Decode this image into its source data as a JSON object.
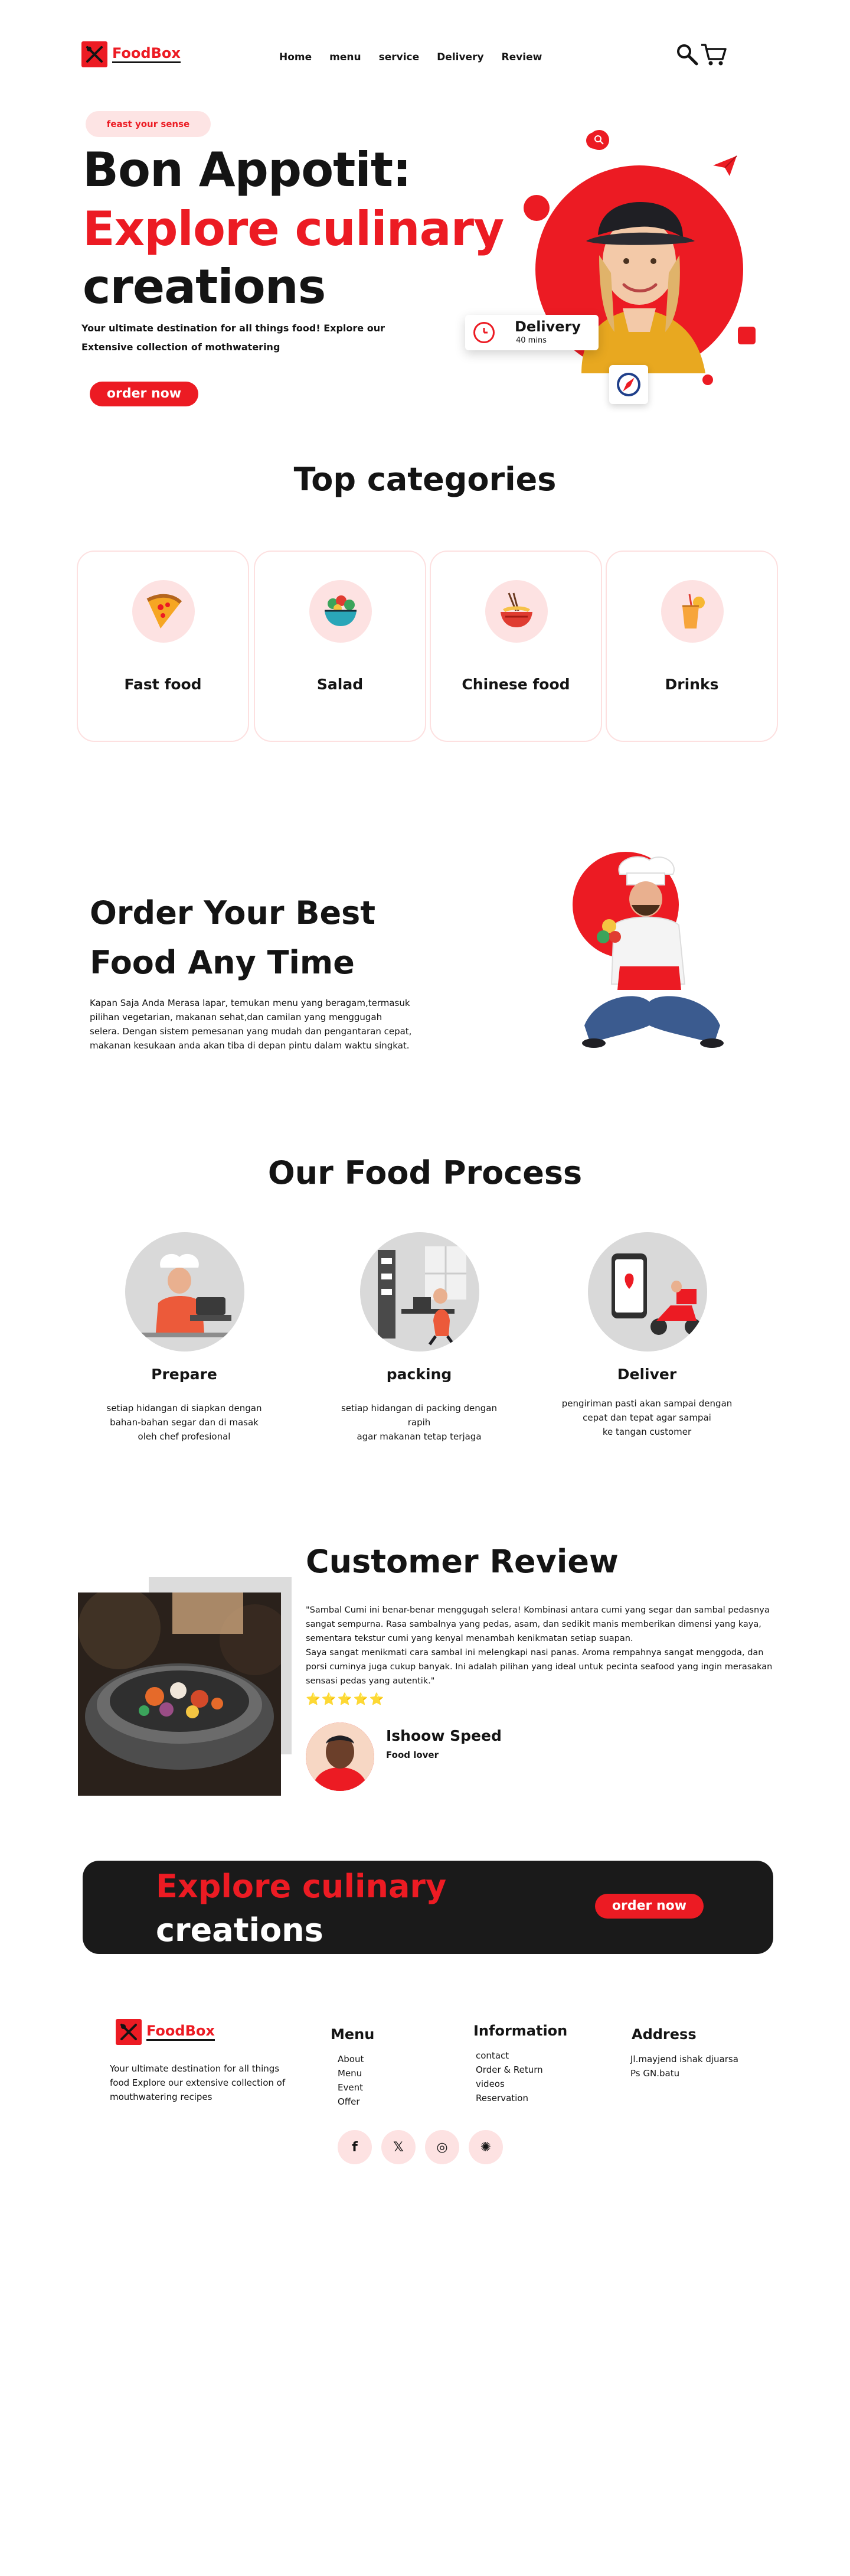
{
  "brand": {
    "name": "FoodBox"
  },
  "nav": {
    "links": [
      "Home",
      "menu",
      "service",
      "Delivery",
      "Review"
    ]
  },
  "hero": {
    "tag": "feast your sense",
    "line1": "Bon Appotit:",
    "line2": "Explore culinary",
    "line3": "creations",
    "subtitle_line1": "Your ultimate destination for all things food! Explore our",
    "subtitle_line2": "Extensive collection of mothwatering",
    "cta": "order now",
    "delivery_title": "Delivery",
    "delivery_time": "40 mins"
  },
  "categories": {
    "title": "Top categories",
    "items": [
      {
        "label": "Fast food",
        "icon": "pizza-icon"
      },
      {
        "label": "Salad",
        "icon": "salad-icon"
      },
      {
        "label": "Chinese food",
        "icon": "noodles-icon"
      },
      {
        "label": "Drinks",
        "icon": "drink-icon"
      }
    ]
  },
  "order": {
    "title_line1": "Order Your Best",
    "title_line2": "Food Any Time",
    "body": [
      "Kapan Saja Anda Merasa lapar, temukan menu yang beragam,termasuk",
      "pilihan vegetarian, makanan sehat,dan camilan yang menggugah",
      "selera. Dengan sistem pemesanan yang mudah dan pengantaran cepat,",
      "makanan kesukaan anda akan tiba di depan pintu dalam waktu singkat."
    ]
  },
  "process": {
    "title": "Our Food Process",
    "steps": [
      {
        "title": "Prepare",
        "desc": [
          "setiap hidangan di siapkan dengan",
          "bahan-bahan segar dan di masak",
          "oleh chef profesional"
        ]
      },
      {
        "title": "packing",
        "desc": [
          "setiap hidangan di packing dengan rapih",
          "agar makanan tetap terjaga"
        ]
      },
      {
        "title": "Deliver",
        "desc": [
          "pengiriman pasti akan sampai dengan",
          "cepat dan tepat agar sampai",
          "ke tangan customer"
        ]
      }
    ]
  },
  "review": {
    "title": "Customer Review",
    "text": [
      "\"Sambal Cumi ini benar-benar menggugah selera! Kombinasi antara cumi yang segar dan sambal pedasnya",
      "sangat sempurna. Rasa sambalnya yang pedas, asam, dan sedikit manis memberikan dimensi yang kaya,",
      "sementara tekstur cumi yang kenyal menambah kenikmatan setiap suapan.",
      "Saya sangat menikmati cara sambal ini melengkapi nasi panas. Aroma rempahnya sangat menggoda, dan",
      "porsi cuminya juga cukup banyak. Ini adalah pilihan yang ideal untuk pecinta seafood yang ingin merasakan",
      "sensasi pedas yang autentik.\""
    ],
    "stars": "⭐⭐⭐⭐⭐",
    "rating": 5,
    "reviewer_name": "Ishoow Speed",
    "reviewer_role": "Food lover"
  },
  "banner": {
    "line1": "Explore culinary",
    "line2": "creations",
    "cta": "order now"
  },
  "footer": {
    "desc": [
      "Your ultimate destination for all things",
      "food Explore our extensive collection of",
      "mouthwatering  recipes"
    ],
    "menu_title": "Menu",
    "menu_items": [
      "About",
      "Menu",
      "Event",
      "Offer"
    ],
    "info_title": "Information",
    "info_items": [
      "contact",
      "Order & Return",
      "videos",
      "Reservation"
    ],
    "address_title": "Address",
    "address_lines": [
      "Jl.mayjend ishak djuarsa",
      "Ps GN.batu"
    ],
    "socials": [
      {
        "label": "f",
        "icon": "facebook-icon"
      },
      {
        "label": "𝕏",
        "icon": "x-icon"
      },
      {
        "label": "◎",
        "icon": "instagram-icon"
      },
      {
        "label": "✺",
        "icon": "threads-icon"
      }
    ]
  },
  "colors": {
    "accent": "#ec1b23",
    "soft_pink": "#fde2e2",
    "dark": "#1a1a1a"
  }
}
